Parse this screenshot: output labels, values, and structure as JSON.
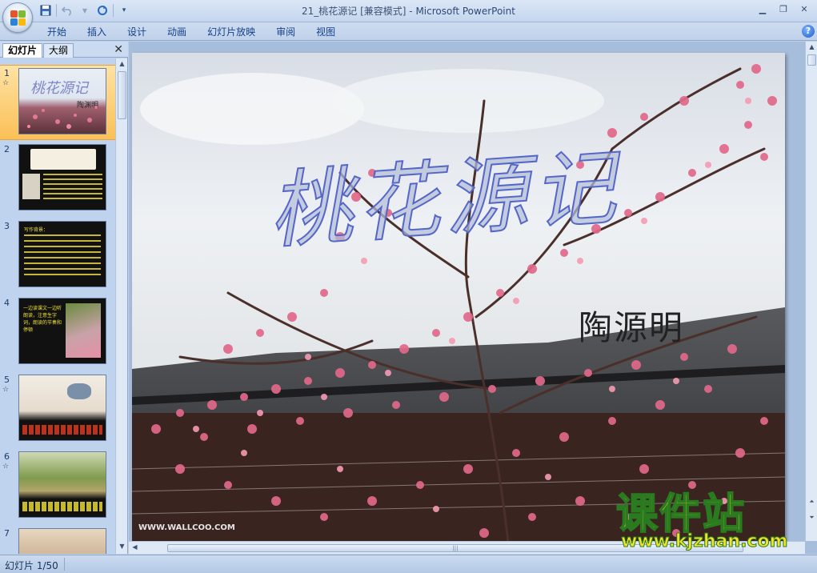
{
  "window": {
    "title": "21_桃花源记 [兼容模式] - ",
    "app_name": "Microsoft PowerPoint"
  },
  "quick_access": {
    "save_icon": "save-icon",
    "undo_icon": "undo-icon",
    "redo_icon": "redo-icon",
    "customize_icon": "customize-qat-icon"
  },
  "ribbon": {
    "tabs": [
      "开始",
      "插入",
      "设计",
      "动画",
      "幻灯片放映",
      "审阅",
      "视图"
    ]
  },
  "pane": {
    "tab_slides": "幻灯片",
    "tab_outline": "大纲",
    "close": "✕"
  },
  "thumbnails": [
    {
      "num": "1",
      "title": "桃花源记",
      "subtitle": "陶渊明"
    },
    {
      "num": "2"
    },
    {
      "num": "3",
      "heading": "写作背景："
    },
    {
      "num": "4",
      "text": "一边读课文一边听朗读，注意生字词，朗读的节奏和停顿"
    },
    {
      "num": "5"
    },
    {
      "num": "6"
    },
    {
      "num": "7"
    }
  ],
  "slide": {
    "title": "桃花源记",
    "author": "陶源明",
    "credit": "WWW.WALLCOO.COM"
  },
  "watermark": {
    "brand": "课件站",
    "url": "www.kjzhan.com"
  },
  "status": {
    "slide_position": "幻灯片 1/50"
  }
}
